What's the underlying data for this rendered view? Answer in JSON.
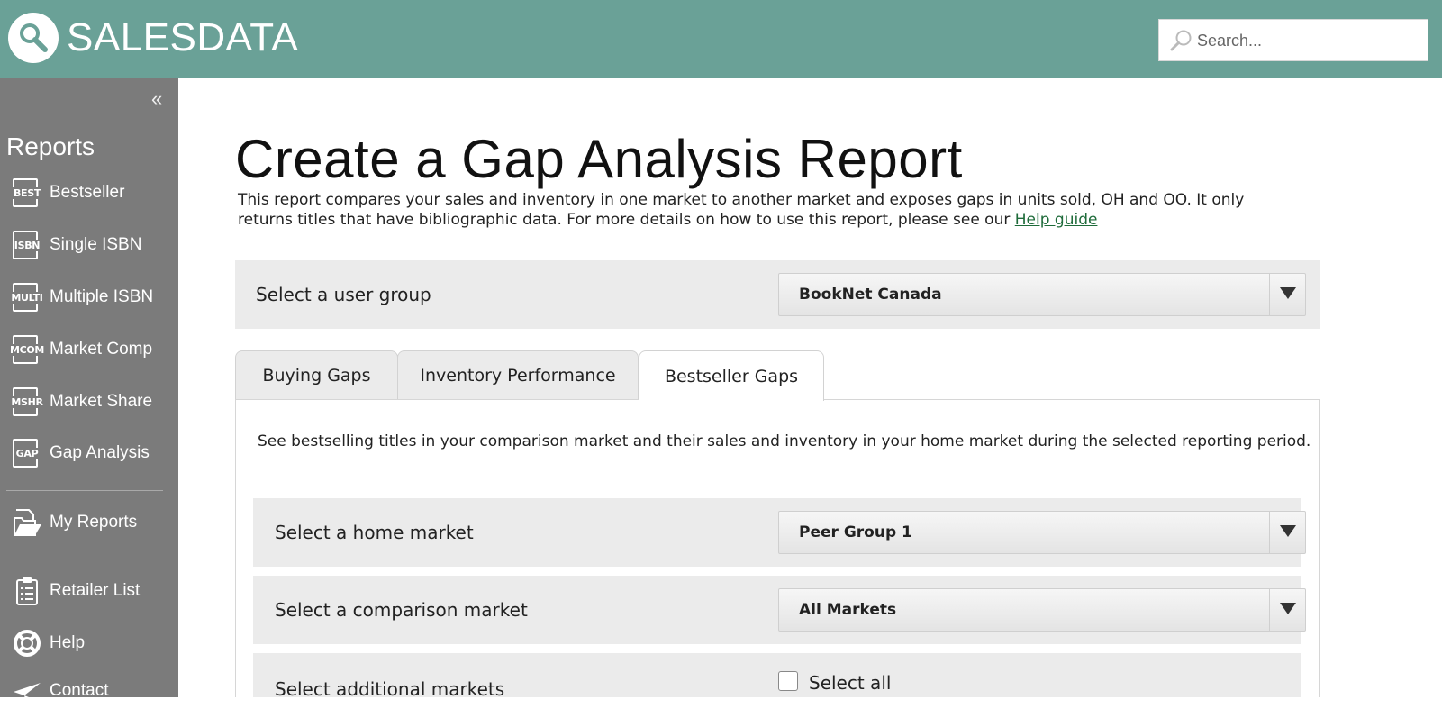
{
  "header": {
    "brand": "SALESDATA",
    "search_placeholder": "Search..."
  },
  "sidebar": {
    "heading": "Reports",
    "items": [
      {
        "abbr": "BEST",
        "label": "Bestseller"
      },
      {
        "abbr": "ISBN",
        "label": "Single ISBN"
      },
      {
        "abbr": "MULTI",
        "label": "Multiple ISBN"
      },
      {
        "abbr": "MCOM",
        "label": "Market Comp"
      },
      {
        "abbr": "MSHR",
        "label": "Market Share"
      },
      {
        "abbr": "GAP",
        "label": "Gap Analysis"
      }
    ],
    "links": [
      {
        "label": "My Reports",
        "icon": "folder-icon"
      },
      {
        "label": "Retailer List",
        "icon": "clipboard-icon"
      },
      {
        "label": "Help",
        "icon": "lifebuoy-icon"
      },
      {
        "label": "Contact",
        "icon": "paper-plane-icon"
      }
    ]
  },
  "main": {
    "title": "Create a Gap Analysis Report",
    "intro_text": "This report compares your sales and inventory in one market to another market and exposes gaps in units sold, OH and OO. It only returns titles that have bibliographic data. For more details on how to use this report, please see our ",
    "help_link": "Help guide",
    "user_group": {
      "label": "Select a user group",
      "value": "BookNet Canada"
    },
    "tabs": [
      {
        "label": "Buying Gaps",
        "active": false
      },
      {
        "label": "Inventory Performance",
        "active": false
      },
      {
        "label": "Bestseller Gaps",
        "active": true
      }
    ],
    "tab_description": "See bestselling titles in your comparison market and their sales and inventory in your home market during the selected reporting period.",
    "home_market": {
      "label": "Select a home market",
      "value": "Peer Group 1"
    },
    "comparison_market": {
      "label": "Select a comparison market",
      "value": "All Markets"
    },
    "additional_markets": {
      "label": "Select additional markets",
      "select_all": "Select all"
    }
  },
  "colors": {
    "header_bg": "#6aa197",
    "sidebar_bg": "#7b7b7b",
    "panel_bg": "#ebebeb",
    "link": "#1e6b3a"
  }
}
